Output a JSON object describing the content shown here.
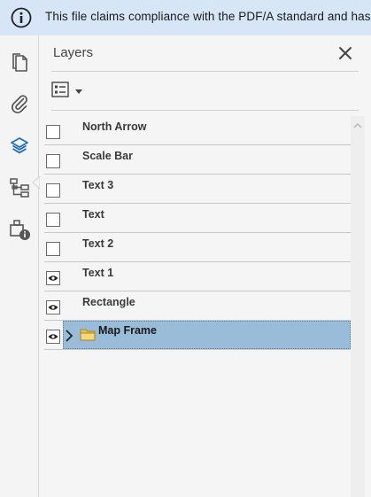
{
  "banner": {
    "message": "This file claims compliance with the PDF/A standard and has"
  },
  "panel": {
    "title": "Layers"
  },
  "layers": [
    {
      "label": "North Arrow",
      "visible": false
    },
    {
      "label": "Scale Bar",
      "visible": false
    },
    {
      "label": "Text 3",
      "visible": false
    },
    {
      "label": "Text",
      "visible": false
    },
    {
      "label": "Text 2",
      "visible": false
    },
    {
      "label": "Text 1",
      "visible": true
    },
    {
      "label": "Rectangle",
      "visible": true
    },
    {
      "label": "Map Frame",
      "visible": true,
      "expandable": true,
      "selected": true
    }
  ],
  "colors": {
    "banner_bg": "#d6e6f7",
    "selection": "#99bdd8",
    "active_icon": "#1c6fc4"
  }
}
